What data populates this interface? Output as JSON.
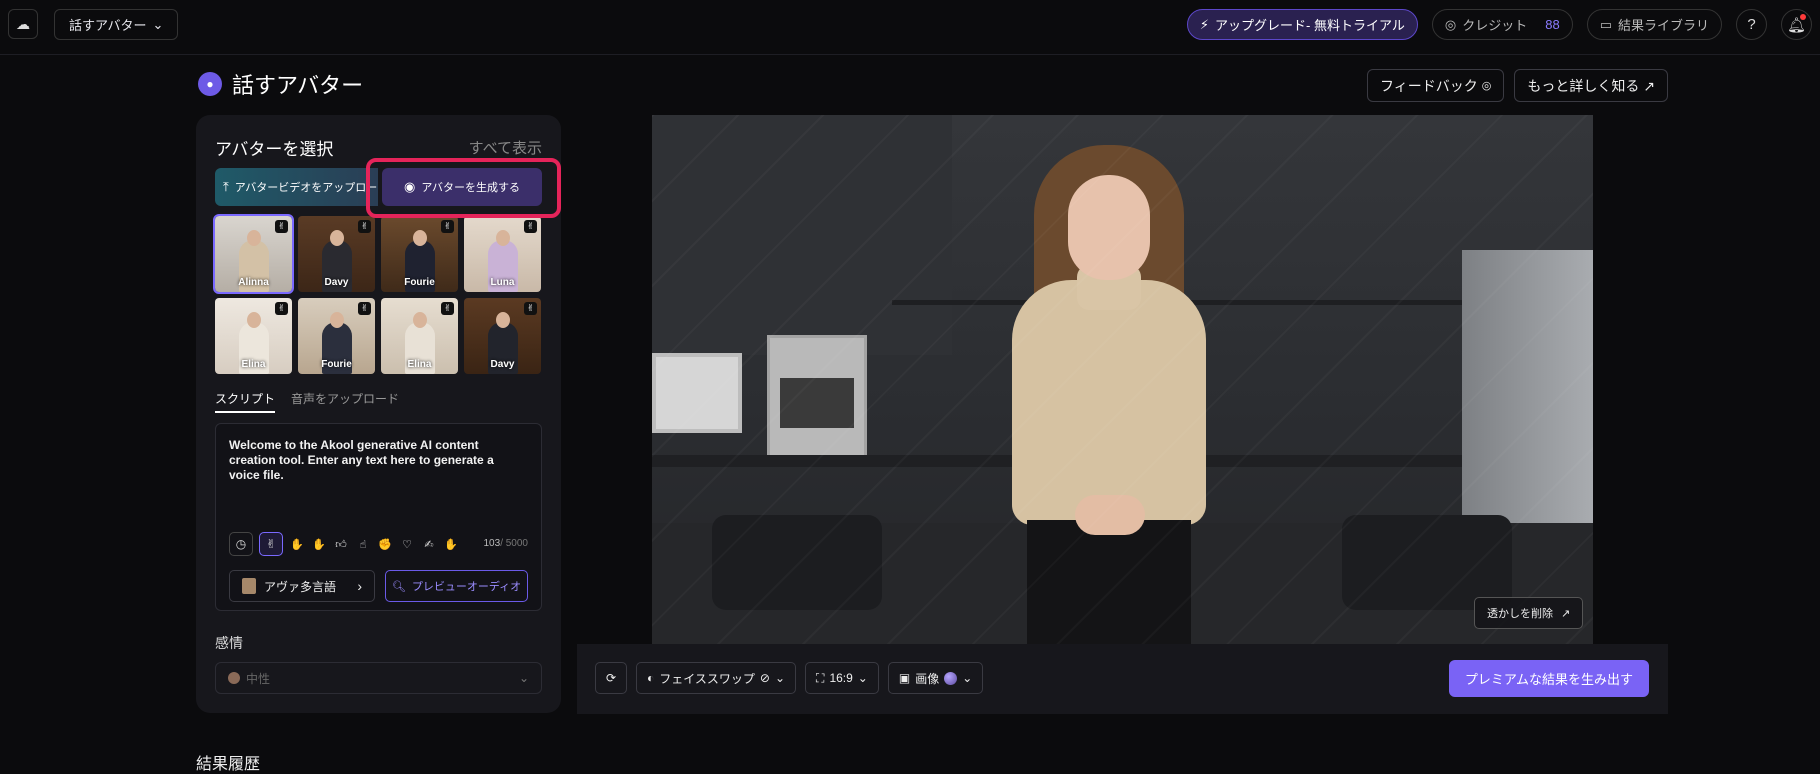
{
  "topbar": {
    "product": "話すアバター",
    "upgrade": "アップグレード- 無料トライアル",
    "credit_label": "クレジット",
    "credit_count": "88",
    "library": "結果ライブラリ",
    "help": "?"
  },
  "page": {
    "title": "話すアバター",
    "feedback": "フィードバック",
    "learn_more": "もっと詳しく知る ↗"
  },
  "avatar_panel": {
    "heading": "アバターを選択",
    "show_all": "すべて表示",
    "upload_video": "アバタービデオをアップロード",
    "generate_avatar": "アバターを生成する",
    "avatars": [
      {
        "name": "Alinna"
      },
      {
        "name": "Davy"
      },
      {
        "name": "Fourie"
      },
      {
        "name": "Luna"
      },
      {
        "name": "Elina"
      },
      {
        "name": "Fourie"
      },
      {
        "name": "Elina"
      },
      {
        "name": "Davy"
      }
    ]
  },
  "script": {
    "tab_script": "スクリプト",
    "tab_upload_audio": "音声をアップロード",
    "text": "Welcome to the Akool generative AI content creation tool. Enter any text here to generate a voice file.",
    "count": "103",
    "max": "/ 5000",
    "voice": "アヴァ多言語",
    "preview_audio": "プレビューオーディオ"
  },
  "emotion": {
    "label": "感情",
    "value": "中性"
  },
  "preview": {
    "remove_watermark": "透かしを削除"
  },
  "bottom_bar": {
    "face_swap": "フェイススワップ",
    "ratio": "16:9",
    "image": "画像",
    "generate": "プレミアムな結果を生み出す"
  },
  "history": {
    "title": "結果履歴"
  }
}
